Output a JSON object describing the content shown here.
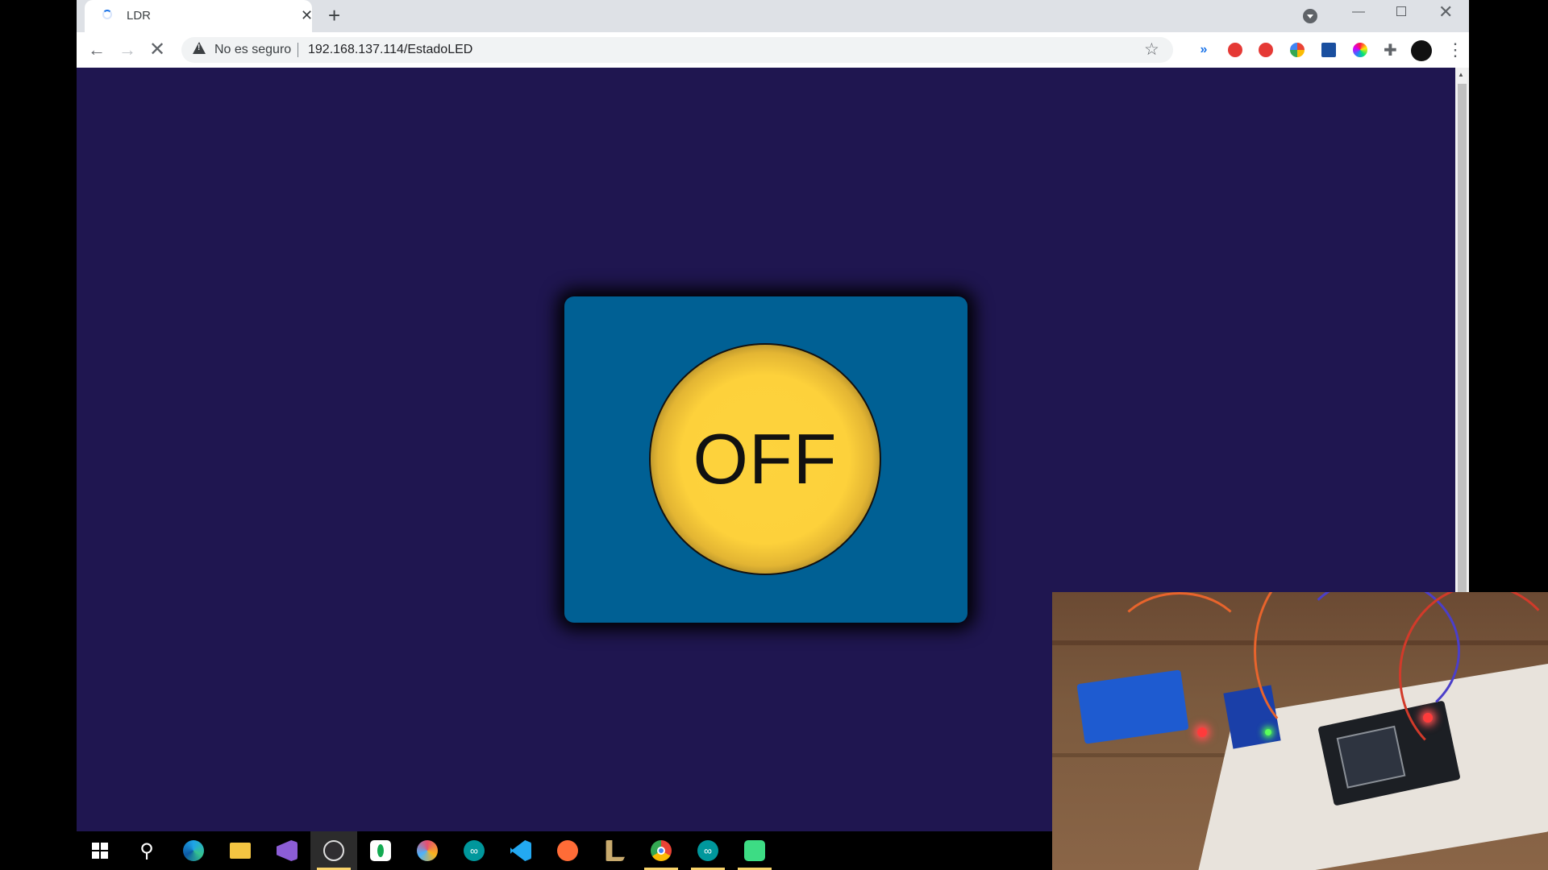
{
  "browser": {
    "tab": {
      "title": "LDR",
      "loading": true
    },
    "omnibox": {
      "security_label": "No es seguro",
      "url": "192.168.137.114/EstadoLED"
    },
    "icons": {
      "back": "back-arrow-icon",
      "forward": "forward-arrow-icon",
      "stop": "stop-loading-icon",
      "star": "bookmark-star-icon",
      "extensions": "puzzle-icon",
      "menu": "kebab-menu-icon"
    }
  },
  "page": {
    "background_color": "#1f1650",
    "card_color": "#006094",
    "led_button": {
      "label": "OFF",
      "color": "#fdd33d"
    }
  },
  "taskbar": {
    "items": [
      "windows-start-icon",
      "search-icon",
      "edge-icon",
      "file-explorer-icon",
      "visual-studio-icon",
      "obs-icon",
      "mongodb-icon",
      "paint-icon",
      "arduino-icon",
      "vscode-icon",
      "postman-icon",
      "league-icon",
      "chrome-icon",
      "arduino-ide-icon",
      "android-studio-icon"
    ]
  },
  "webcam": {
    "subject": "breadboard-circuit"
  }
}
